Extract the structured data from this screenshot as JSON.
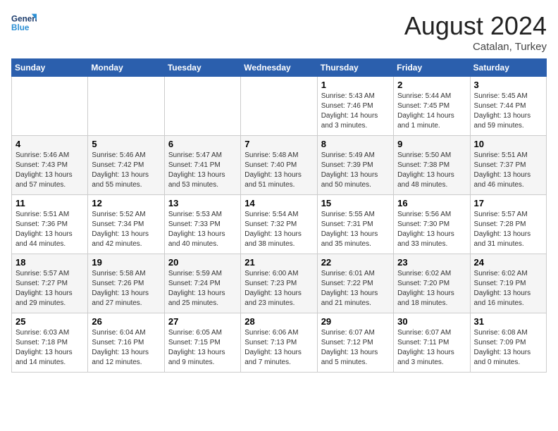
{
  "header": {
    "logo_line1": "General",
    "logo_line2": "Blue",
    "month_year": "August 2024",
    "location": "Catalan, Turkey"
  },
  "weekdays": [
    "Sunday",
    "Monday",
    "Tuesday",
    "Wednesday",
    "Thursday",
    "Friday",
    "Saturday"
  ],
  "weeks": [
    [
      {
        "day": "",
        "info": ""
      },
      {
        "day": "",
        "info": ""
      },
      {
        "day": "",
        "info": ""
      },
      {
        "day": "",
        "info": ""
      },
      {
        "day": "1",
        "info": "Sunrise: 5:43 AM\nSunset: 7:46 PM\nDaylight: 14 hours\nand 3 minutes."
      },
      {
        "day": "2",
        "info": "Sunrise: 5:44 AM\nSunset: 7:45 PM\nDaylight: 14 hours\nand 1 minute."
      },
      {
        "day": "3",
        "info": "Sunrise: 5:45 AM\nSunset: 7:44 PM\nDaylight: 13 hours\nand 59 minutes."
      }
    ],
    [
      {
        "day": "4",
        "info": "Sunrise: 5:46 AM\nSunset: 7:43 PM\nDaylight: 13 hours\nand 57 minutes."
      },
      {
        "day": "5",
        "info": "Sunrise: 5:46 AM\nSunset: 7:42 PM\nDaylight: 13 hours\nand 55 minutes."
      },
      {
        "day": "6",
        "info": "Sunrise: 5:47 AM\nSunset: 7:41 PM\nDaylight: 13 hours\nand 53 minutes."
      },
      {
        "day": "7",
        "info": "Sunrise: 5:48 AM\nSunset: 7:40 PM\nDaylight: 13 hours\nand 51 minutes."
      },
      {
        "day": "8",
        "info": "Sunrise: 5:49 AM\nSunset: 7:39 PM\nDaylight: 13 hours\nand 50 minutes."
      },
      {
        "day": "9",
        "info": "Sunrise: 5:50 AM\nSunset: 7:38 PM\nDaylight: 13 hours\nand 48 minutes."
      },
      {
        "day": "10",
        "info": "Sunrise: 5:51 AM\nSunset: 7:37 PM\nDaylight: 13 hours\nand 46 minutes."
      }
    ],
    [
      {
        "day": "11",
        "info": "Sunrise: 5:51 AM\nSunset: 7:36 PM\nDaylight: 13 hours\nand 44 minutes."
      },
      {
        "day": "12",
        "info": "Sunrise: 5:52 AM\nSunset: 7:34 PM\nDaylight: 13 hours\nand 42 minutes."
      },
      {
        "day": "13",
        "info": "Sunrise: 5:53 AM\nSunset: 7:33 PM\nDaylight: 13 hours\nand 40 minutes."
      },
      {
        "day": "14",
        "info": "Sunrise: 5:54 AM\nSunset: 7:32 PM\nDaylight: 13 hours\nand 38 minutes."
      },
      {
        "day": "15",
        "info": "Sunrise: 5:55 AM\nSunset: 7:31 PM\nDaylight: 13 hours\nand 35 minutes."
      },
      {
        "day": "16",
        "info": "Sunrise: 5:56 AM\nSunset: 7:30 PM\nDaylight: 13 hours\nand 33 minutes."
      },
      {
        "day": "17",
        "info": "Sunrise: 5:57 AM\nSunset: 7:28 PM\nDaylight: 13 hours\nand 31 minutes."
      }
    ],
    [
      {
        "day": "18",
        "info": "Sunrise: 5:57 AM\nSunset: 7:27 PM\nDaylight: 13 hours\nand 29 minutes."
      },
      {
        "day": "19",
        "info": "Sunrise: 5:58 AM\nSunset: 7:26 PM\nDaylight: 13 hours\nand 27 minutes."
      },
      {
        "day": "20",
        "info": "Sunrise: 5:59 AM\nSunset: 7:24 PM\nDaylight: 13 hours\nand 25 minutes."
      },
      {
        "day": "21",
        "info": "Sunrise: 6:00 AM\nSunset: 7:23 PM\nDaylight: 13 hours\nand 23 minutes."
      },
      {
        "day": "22",
        "info": "Sunrise: 6:01 AM\nSunset: 7:22 PM\nDaylight: 13 hours\nand 21 minutes."
      },
      {
        "day": "23",
        "info": "Sunrise: 6:02 AM\nSunset: 7:20 PM\nDaylight: 13 hours\nand 18 minutes."
      },
      {
        "day": "24",
        "info": "Sunrise: 6:02 AM\nSunset: 7:19 PM\nDaylight: 13 hours\nand 16 minutes."
      }
    ],
    [
      {
        "day": "25",
        "info": "Sunrise: 6:03 AM\nSunset: 7:18 PM\nDaylight: 13 hours\nand 14 minutes."
      },
      {
        "day": "26",
        "info": "Sunrise: 6:04 AM\nSunset: 7:16 PM\nDaylight: 13 hours\nand 12 minutes."
      },
      {
        "day": "27",
        "info": "Sunrise: 6:05 AM\nSunset: 7:15 PM\nDaylight: 13 hours\nand 9 minutes."
      },
      {
        "day": "28",
        "info": "Sunrise: 6:06 AM\nSunset: 7:13 PM\nDaylight: 13 hours\nand 7 minutes."
      },
      {
        "day": "29",
        "info": "Sunrise: 6:07 AM\nSunset: 7:12 PM\nDaylight: 13 hours\nand 5 minutes."
      },
      {
        "day": "30",
        "info": "Sunrise: 6:07 AM\nSunset: 7:11 PM\nDaylight: 13 hours\nand 3 minutes."
      },
      {
        "day": "31",
        "info": "Sunrise: 6:08 AM\nSunset: 7:09 PM\nDaylight: 13 hours\nand 0 minutes."
      }
    ]
  ]
}
